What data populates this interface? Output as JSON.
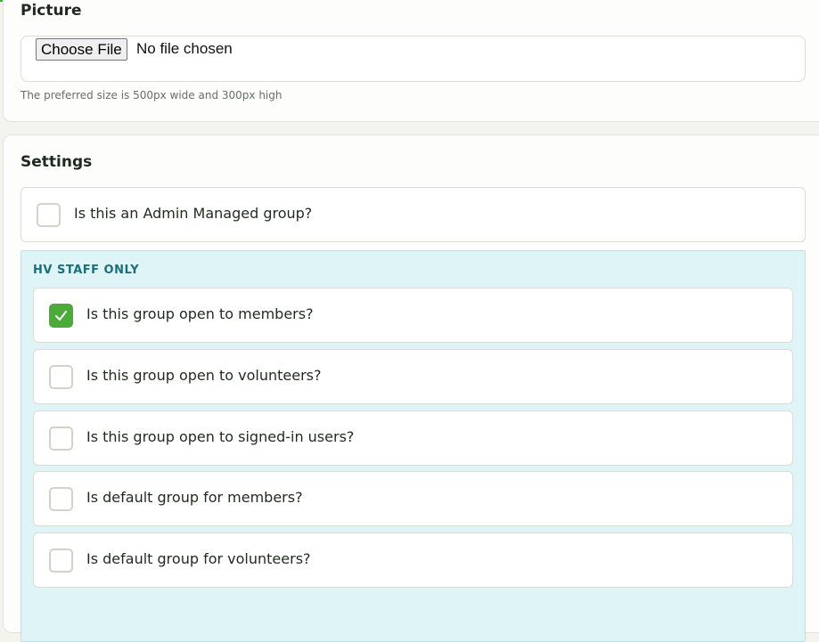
{
  "picture": {
    "title": "Picture",
    "file_button": "Choose File",
    "file_status": "No file chosen",
    "help": "The preferred size is 500px wide and 300px high"
  },
  "settings": {
    "title": "Settings",
    "admin_managed": {
      "label": "Is this an Admin Managed group?",
      "checked": false
    },
    "staff_panel": {
      "title": "HV STAFF ONLY",
      "items": [
        {
          "label": "Is this group open to members?",
          "checked": true
        },
        {
          "label": "Is this group open to volunteers?",
          "checked": false
        },
        {
          "label": "Is this group open to signed-in users?",
          "checked": false
        },
        {
          "label": "Is default group for members?",
          "checked": false
        },
        {
          "label": "Is default group for volunteers?",
          "checked": false
        }
      ]
    }
  },
  "colors": {
    "accent": "#4caa3a",
    "staff_panel_bg": "#dff4f6",
    "staff_title": "#1a6f78"
  },
  "icons": {
    "checked": "checkmark-icon"
  }
}
